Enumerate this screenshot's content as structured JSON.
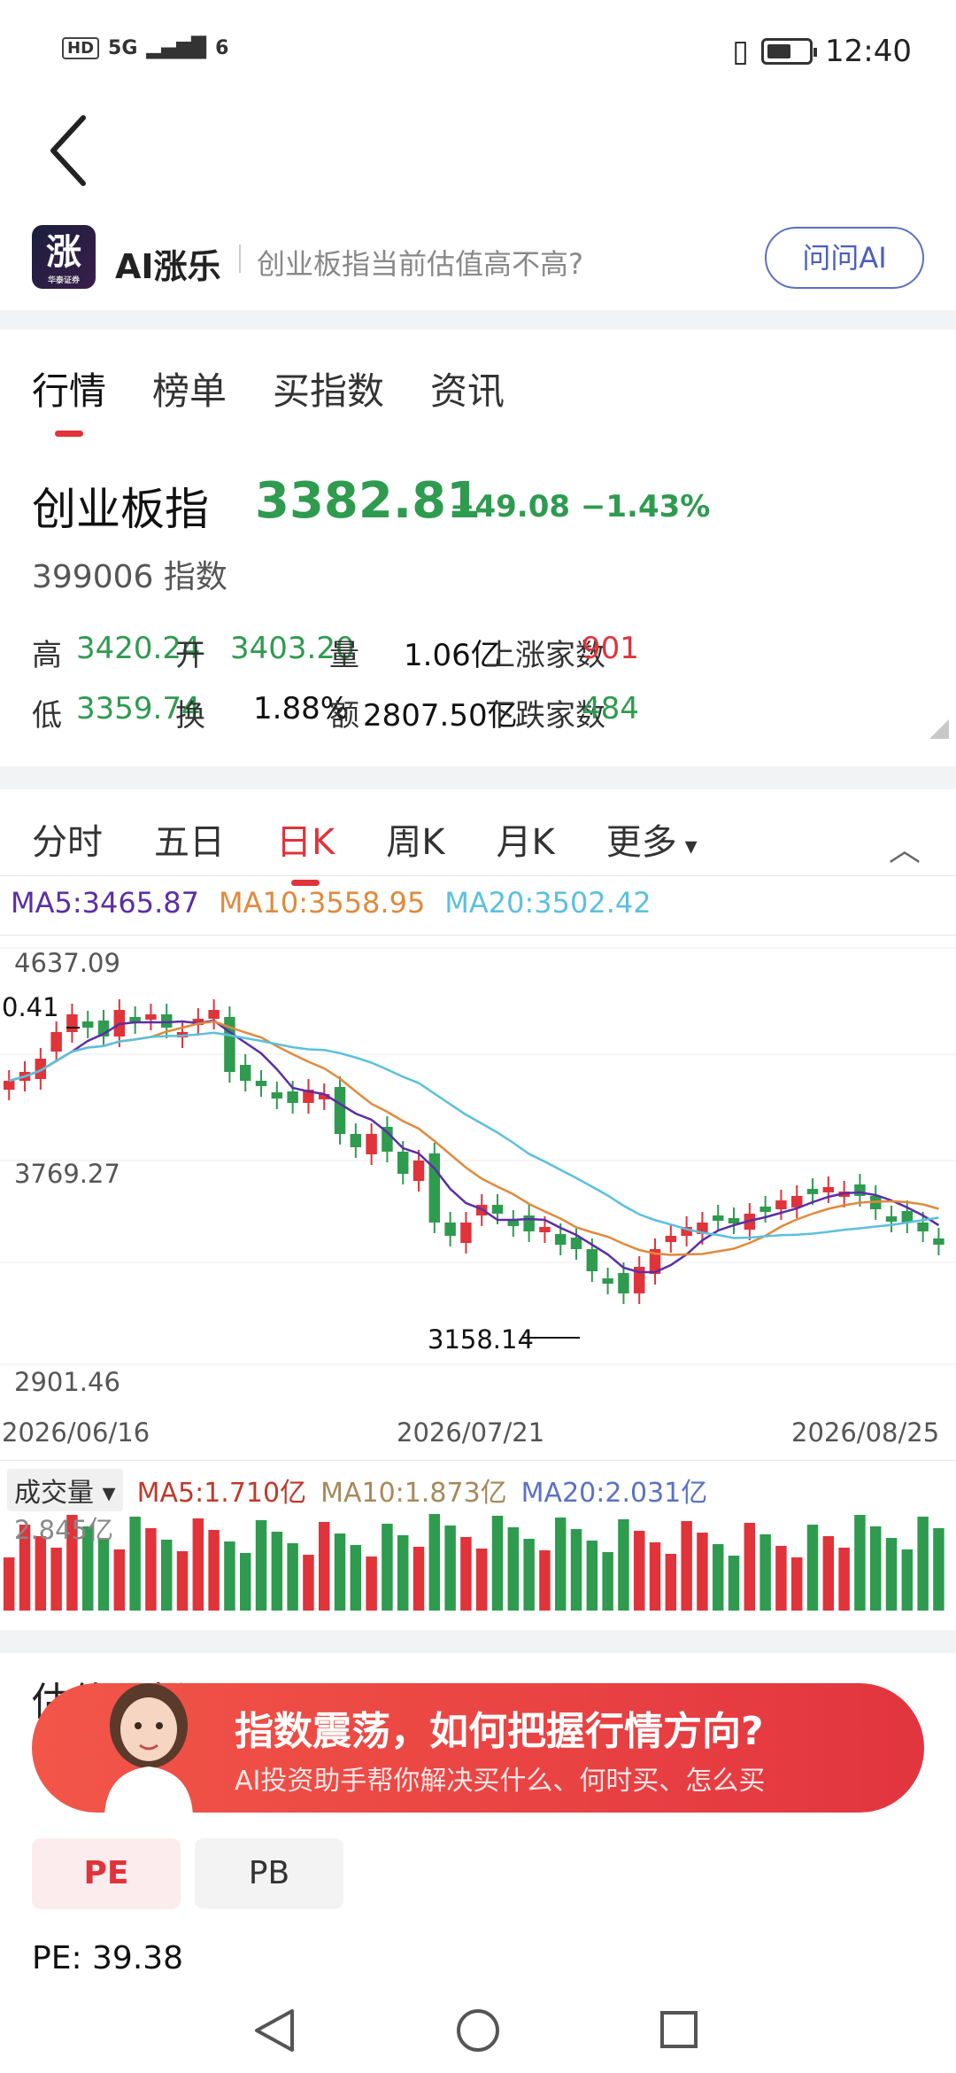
{
  "status": {
    "network": "5G",
    "wifi": "6",
    "time": "12:40"
  },
  "ai_bar": {
    "logo_glyph": "涨",
    "logo_sub": "华泰证券",
    "title": "AI涨乐",
    "question": "创业板指当前估值高不高?",
    "ask_label": "问问AI"
  },
  "main_tabs": [
    "行情",
    "榜单",
    "买指数",
    "资讯"
  ],
  "index": {
    "name": "创业板指",
    "price": "3382.81",
    "change": "−49.08",
    "change_pct": "−1.43%",
    "code": "399006",
    "type": "指数"
  },
  "stats": {
    "high_label": "高",
    "high": "3420.24",
    "open_label": "开",
    "open": "3403.20",
    "vol_label": "量",
    "vol": "1.06亿",
    "up_label": "上涨家数",
    "up": "901",
    "low_label": "低",
    "low": "3359.74",
    "turn_label": "换",
    "turn": "1.88%",
    "amt_label": "额",
    "amt": "2807.50亿",
    "down_label": "下跌家数",
    "down": "484"
  },
  "period_tabs": [
    "分时",
    "五日",
    "日K",
    "周K",
    "月K",
    "更多"
  ],
  "ma": {
    "ma5": "MA5:3465.87",
    "ma10": "MA10:3558.95",
    "ma20": "MA20:3502.42"
  },
  "chart_labels": {
    "top": "4637.09",
    "mid": "3769.27",
    "bottom": "2901.46",
    "high_mark": "0.41",
    "low_mark": "3158.14",
    "d1": "2026/06/16",
    "d2": "2026/07/21",
    "d3": "2026/08/25"
  },
  "volume": {
    "selector": "成交量",
    "ma5": "MA5:1.710亿",
    "ma10": "MA10:1.873亿",
    "ma20": "MA20:2.031亿",
    "peak": "2.845亿"
  },
  "colors": {
    "up": "#e0333a",
    "down": "#2e9b4f",
    "ma5": "#5b2ea6",
    "ma10": "#e08a3c",
    "ma20": "#5bc0de"
  },
  "banner": {
    "title": "指数震荡，如何把握行情方向?",
    "subtitle": "AI投资助手帮你解决买什么、何时买、怎么买"
  },
  "hidden_title": "估值分析",
  "valuation": {
    "pe_label": "PE",
    "pb_label": "PB",
    "pe_value": "PE: 39.38"
  }
}
